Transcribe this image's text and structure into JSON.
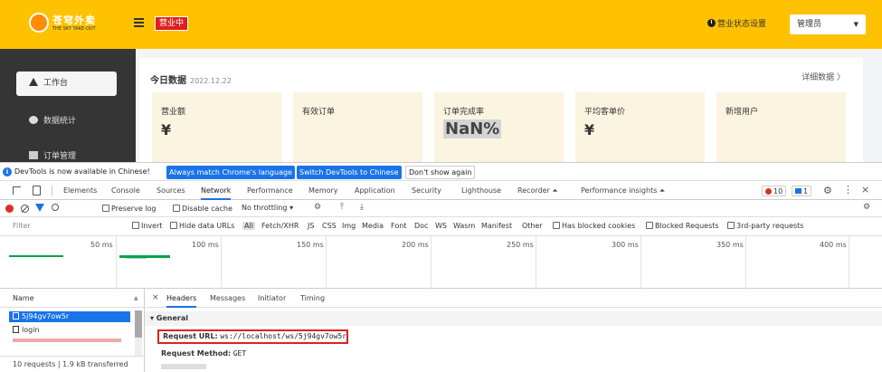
{
  "app": {
    "logo_title": "苍穹外卖",
    "logo_subtitle": "THE SKY TAKE-OUT",
    "status_tag": "营业中",
    "shop_status_label": "营业状态设置",
    "admin_label": "管理员",
    "accent_color": "#ffc200"
  },
  "sidebar": {
    "items": [
      {
        "label": "工作台",
        "icon": "home-icon",
        "active": true
      },
      {
        "label": "数据统计",
        "icon": "chart-icon",
        "active": false
      },
      {
        "label": "订单管理",
        "icon": "order-icon",
        "active": false
      }
    ]
  },
  "dashboard": {
    "title": "今日数据",
    "date": "2022.12.22",
    "details_link": "详细数据 〉",
    "stats": [
      {
        "label": "营业额",
        "value": "¥"
      },
      {
        "label": "有效订单",
        "value": ""
      },
      {
        "label": "订单完成率",
        "value": "NaN%"
      },
      {
        "label": "平均客单价",
        "value": "¥"
      },
      {
        "label": "新增用户",
        "value": ""
      }
    ]
  },
  "devtools": {
    "infobar": {
      "text": "DevTools is now available in Chinese!",
      "match_button": "Always match Chrome's language",
      "switch_button": "Switch DevTools to Chinese",
      "dismiss_button": "Don't show again"
    },
    "tabs": [
      "Elements",
      "Console",
      "Sources",
      "Network",
      "Performance",
      "Memory",
      "Application",
      "Security",
      "Lighthouse",
      "Recorder ⏶",
      "Performance insights ⏶"
    ],
    "active_tab": "Network",
    "error_count": "10",
    "message_count": "1",
    "toolbar": {
      "preserve_log": "Preserve log",
      "disable_cache": "Disable cache",
      "throttling": "No throttling"
    },
    "filter": {
      "placeholder": "Filter",
      "invert": "Invert",
      "hide_data_urls": "Hide data URLs",
      "types": [
        "All",
        "Fetch/XHR",
        "JS",
        "CSS",
        "Img",
        "Media",
        "Font",
        "Doc",
        "WS",
        "Wasm",
        "Manifest",
        "Other"
      ],
      "blocked_cookies": "Has blocked cookies",
      "blocked_requests": "Blocked Requests",
      "third_party": "3rd-party requests"
    },
    "timeline_ticks": [
      "50 ms",
      "100 ms",
      "150 ms",
      "200 ms",
      "250 ms",
      "300 ms",
      "350 ms",
      "400 ms"
    ],
    "requests": {
      "header": "Name",
      "items": [
        "5j94gv7ow5r",
        "login"
      ],
      "footer": "10 requests  |  1.9 kB transferred"
    },
    "detail": {
      "tabs": [
        "Headers",
        "Messages",
        "Initiator",
        "Timing"
      ],
      "active_tab": "Headers",
      "general_label": "▾ General",
      "request_url_key": "Request URL:",
      "request_url_value": "ws://localhost/ws/5j94gv7ow5r",
      "request_method_key": "Request Method:",
      "request_method_value": "GET"
    }
  }
}
